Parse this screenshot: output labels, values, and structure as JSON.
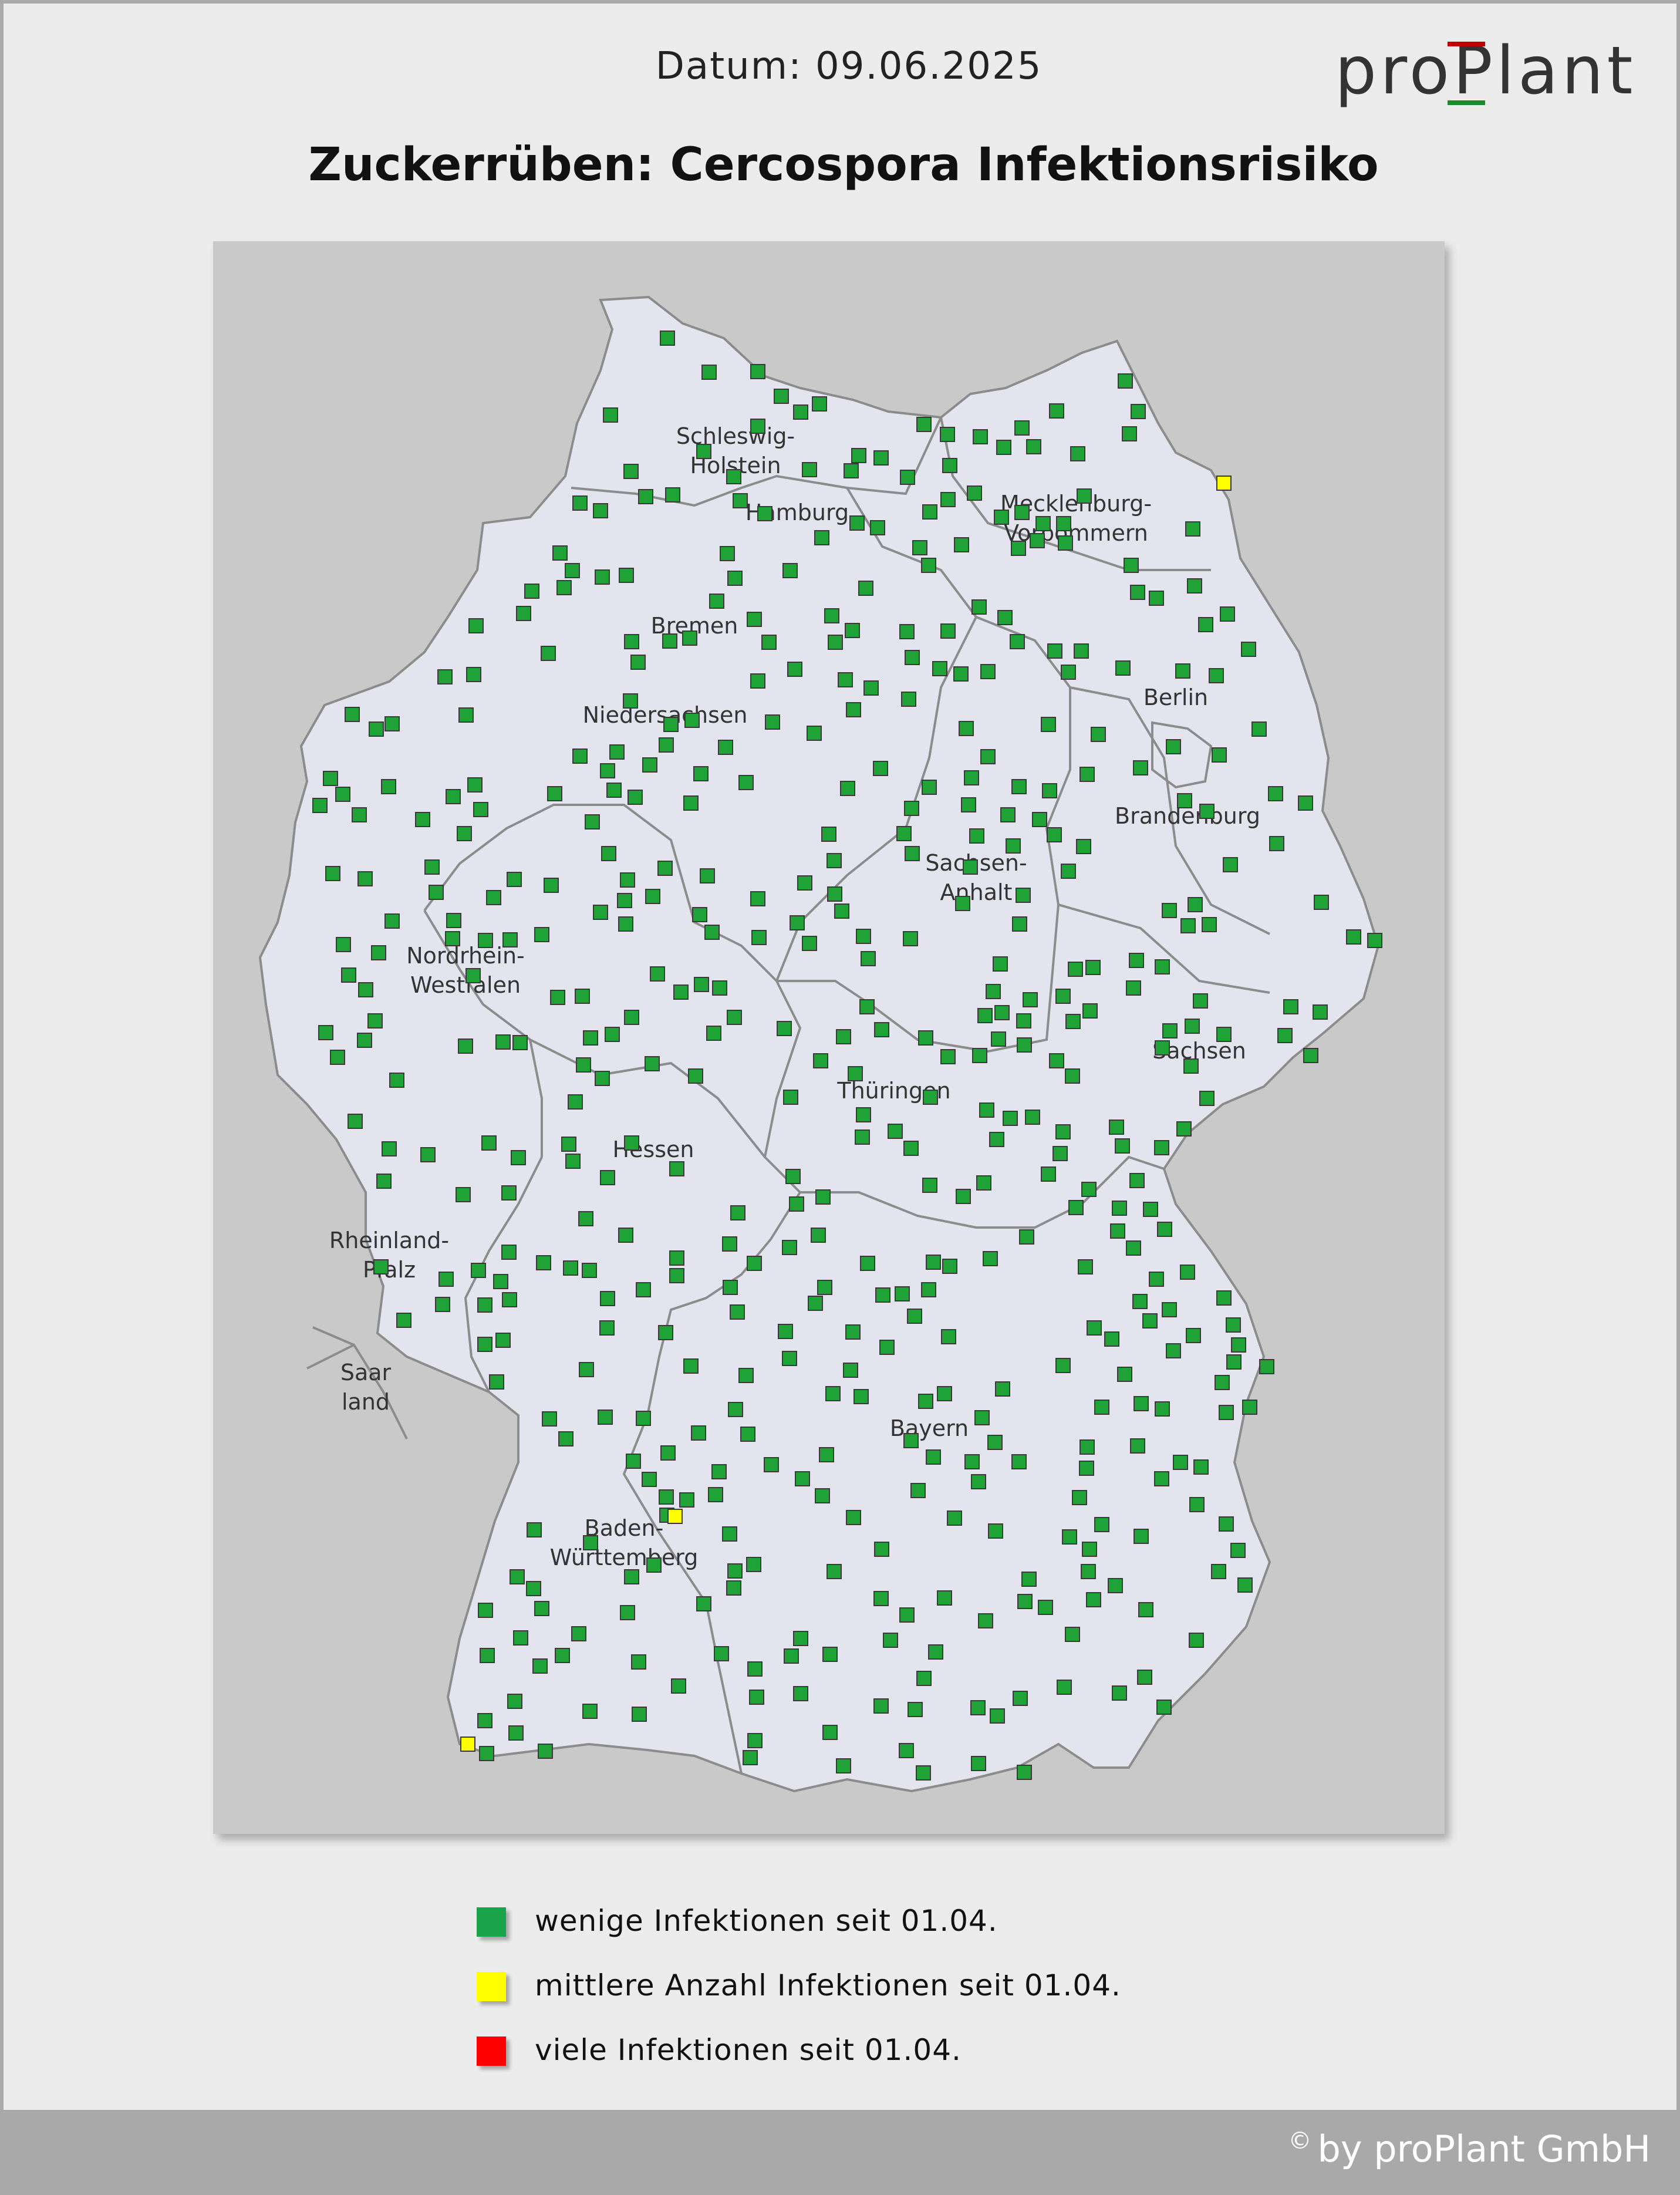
{
  "header": {
    "date_text": "Datum: 09.06.2025",
    "logo_text": "proPlant",
    "title": "Zuckerrüben: Cercospora Infektionsrisiko"
  },
  "map": {
    "country": "Deutschland",
    "regions": [
      {
        "name_lines": [
          "Schleswig-",
          "Holstein"
        ]
      },
      {
        "name_lines": [
          "Hamburg"
        ]
      },
      {
        "name_lines": [
          "Mecklenburg-",
          "Vorpommern"
        ]
      },
      {
        "name_lines": [
          "Bremen"
        ]
      },
      {
        "name_lines": [
          "Niedersachsen"
        ]
      },
      {
        "name_lines": [
          "Berlin"
        ]
      },
      {
        "name_lines": [
          "Brandenburg"
        ]
      },
      {
        "name_lines": [
          "Sachsen-",
          "Anhalt"
        ]
      },
      {
        "name_lines": [
          "Nordrhein-",
          "Westfalen"
        ]
      },
      {
        "name_lines": [
          "Sachsen"
        ]
      },
      {
        "name_lines": [
          "Thüringen"
        ]
      },
      {
        "name_lines": [
          "Hessen"
        ]
      },
      {
        "name_lines": [
          "Rheinland-",
          "Pfalz"
        ]
      },
      {
        "name_lines": [
          "Saar",
          "land"
        ]
      },
      {
        "name_lines": [
          "Bayern"
        ]
      },
      {
        "name_lines": [
          "Baden-",
          "Württemberg"
        ]
      }
    ],
    "marker_colors": {
      "low": "#1fa337",
      "medium": "#ffff00",
      "high": "#ff0000"
    },
    "yellow_station_count": 3
  },
  "legend": [
    {
      "label": "wenige Infektionen seit 01.04.",
      "color": "#1aa34a"
    },
    {
      "label": "mittlere Anzahl Infektionen seit 01.04.",
      "color": "#ffff00"
    },
    {
      "label": "viele Infektionen seit 01.04.",
      "color": "#ff0000"
    }
  ],
  "footer": {
    "copyright_symbol": "©",
    "copyright_text": "by proPlant GmbH"
  },
  "colors": {
    "background": "#ececec",
    "map_panel": "#c9c9c9",
    "land_fill": "#e4e4ee",
    "border_stroke": "#8c8c8c",
    "footer_bar": "#a9a9a9",
    "logo_dark": "#333333",
    "logo_accent_red": "#c00000",
    "logo_accent_green": "#1a8a2a"
  }
}
